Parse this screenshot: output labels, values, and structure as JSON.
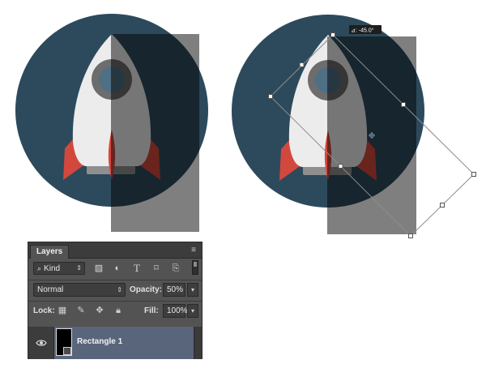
{
  "canvas": {
    "rotation_readout": "⊿: -45.0°",
    "colors": {
      "circle": "#2d4a5c",
      "rocket_body": "#ececec",
      "window_ring": "#6d6d6d",
      "window_glass": "#4f6f85",
      "fins": "#d3483d",
      "base": "#8f8f8f",
      "overlay_rect": "#000000",
      "overlay_opacity": 0.5
    }
  },
  "layers_panel": {
    "tab_label": "Layers",
    "filter": {
      "kind_label": "Kind",
      "icons": [
        "image-filter-icon",
        "adjustment-filter-icon",
        "type-filter-icon",
        "shape-filter-icon",
        "smart-object-filter-icon"
      ]
    },
    "blend_mode": "Normal",
    "opacity_label": "Opacity:",
    "opacity_value": "50%",
    "lock_label": "Lock:",
    "fill_label": "Fill:",
    "fill_value": "100%",
    "layers": [
      {
        "name": "Rectangle 1",
        "visible": true,
        "selected": true
      }
    ],
    "colors": {
      "panel_bg": "#535353",
      "tab_bar_bg": "#3c3c3c",
      "selection": "#59657a"
    }
  }
}
